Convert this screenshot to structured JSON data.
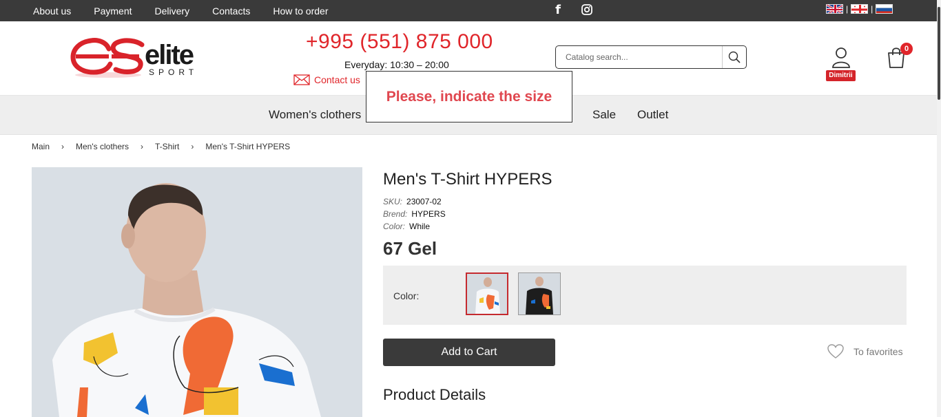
{
  "topbar": {
    "nav": [
      "About us",
      "Payment",
      "Delivery",
      "Contacts",
      "How to order"
    ],
    "social": {
      "facebook_glyph": "f",
      "facebook_icon": "facebook-icon",
      "instagram_icon": "instagram-icon"
    },
    "languages": [
      "flag-uk-icon",
      "flag-georgia-icon",
      "flag-russia-icon"
    ]
  },
  "header": {
    "logo_text": "elite",
    "logo_sub": "SPORT",
    "phone": "+995 (551) 875 000",
    "hours": "Everyday: 10:30 – 20:00",
    "contact_label": "Contact us",
    "search_placeholder": "Catalog search...",
    "user_name": "Dimitrii",
    "cart_count": "0"
  },
  "mainnav": {
    "items": [
      "Women's clothers",
      "Sale",
      "Outlet"
    ]
  },
  "popup": {
    "message": "Please, indicate the size"
  },
  "breadcrumb": {
    "items": [
      "Main",
      "Men's clothers",
      "T-Shirt",
      "Men's T-Shirt HYPERS"
    ],
    "separator": "›"
  },
  "product": {
    "title": "Men's T-Shirt HYPERS",
    "sku_label": "SKU:",
    "sku": "23007-02",
    "brand_label": "Brend:",
    "brand": "HYPERS",
    "color_label": "Color:",
    "color": "While",
    "price": "67 Gel",
    "color_picker_label": "Color:",
    "add_to_cart": "Add to Cart",
    "favorites": "To favorites",
    "details_heading": "Product Details"
  },
  "colors": {
    "accent": "#e0252a",
    "dark": "#3a3a3a",
    "popup_text": "#e0474f"
  }
}
